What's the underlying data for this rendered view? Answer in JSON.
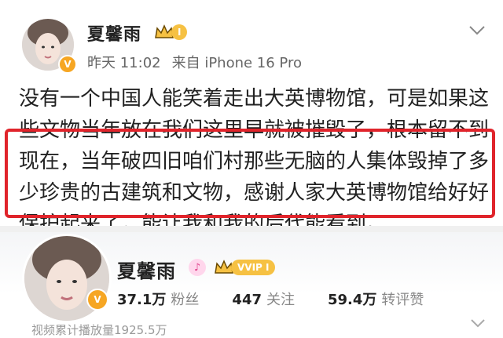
{
  "post": {
    "author": "夏馨雨",
    "vip_level": "I",
    "verified_symbol": "V",
    "time": "昨天 11:02",
    "source": "来自 iPhone 16 Pro",
    "text_lines": [
      "没有一个中国人能笑着走出大英博物馆，可是如果这",
      "些文物当年放在我们这里早就被摧毁了，根本留不到",
      "现在，当年破四旧咱们村那些无脑的人集体毁掉了多",
      "少珍贵的古建筑和文物，感谢人家大英博物馆给好好",
      "保护起来了，能让我和我的后代能看到。"
    ],
    "highlight_color": "#e0242b"
  },
  "profile": {
    "name": "夏馨雨",
    "tiktok_symbol": "♪",
    "vip_label": "VVIP I",
    "verified_symbol": "V",
    "stats": [
      {
        "value": "37.1万",
        "label": "粉丝"
      },
      {
        "value": "447",
        "label": "关注"
      },
      {
        "value": "59.4万",
        "label": "转评赞"
      }
    ],
    "footer": "视频累计播放量1925.5万"
  },
  "colors": {
    "accent": "#f6a623",
    "vip": "#f6c143"
  },
  "icons": [
    "chevron-down-icon",
    "crown-icon",
    "verified-icon",
    "tiktok-icon"
  ]
}
